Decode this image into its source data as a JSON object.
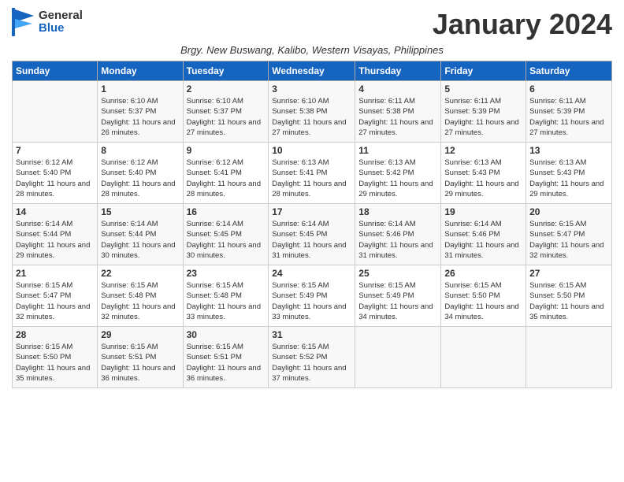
{
  "header": {
    "logo_general": "General",
    "logo_blue": "Blue",
    "month_title": "January 2024",
    "subtitle": "Brgy. New Buswang, Kalibo, Western Visayas, Philippines"
  },
  "days_of_week": [
    "Sunday",
    "Monday",
    "Tuesday",
    "Wednesday",
    "Thursday",
    "Friday",
    "Saturday"
  ],
  "weeks": [
    [
      {
        "day": "",
        "info": ""
      },
      {
        "day": "1",
        "info": "Sunrise: 6:10 AM\nSunset: 5:37 PM\nDaylight: 11 hours and 26 minutes."
      },
      {
        "day": "2",
        "info": "Sunrise: 6:10 AM\nSunset: 5:37 PM\nDaylight: 11 hours and 27 minutes."
      },
      {
        "day": "3",
        "info": "Sunrise: 6:10 AM\nSunset: 5:38 PM\nDaylight: 11 hours and 27 minutes."
      },
      {
        "day": "4",
        "info": "Sunrise: 6:11 AM\nSunset: 5:38 PM\nDaylight: 11 hours and 27 minutes."
      },
      {
        "day": "5",
        "info": "Sunrise: 6:11 AM\nSunset: 5:39 PM\nDaylight: 11 hours and 27 minutes."
      },
      {
        "day": "6",
        "info": "Sunrise: 6:11 AM\nSunset: 5:39 PM\nDaylight: 11 hours and 27 minutes."
      }
    ],
    [
      {
        "day": "7",
        "info": "Sunrise: 6:12 AM\nSunset: 5:40 PM\nDaylight: 11 hours and 28 minutes."
      },
      {
        "day": "8",
        "info": "Sunrise: 6:12 AM\nSunset: 5:40 PM\nDaylight: 11 hours and 28 minutes."
      },
      {
        "day": "9",
        "info": "Sunrise: 6:12 AM\nSunset: 5:41 PM\nDaylight: 11 hours and 28 minutes."
      },
      {
        "day": "10",
        "info": "Sunrise: 6:13 AM\nSunset: 5:41 PM\nDaylight: 11 hours and 28 minutes."
      },
      {
        "day": "11",
        "info": "Sunrise: 6:13 AM\nSunset: 5:42 PM\nDaylight: 11 hours and 29 minutes."
      },
      {
        "day": "12",
        "info": "Sunrise: 6:13 AM\nSunset: 5:43 PM\nDaylight: 11 hours and 29 minutes."
      },
      {
        "day": "13",
        "info": "Sunrise: 6:13 AM\nSunset: 5:43 PM\nDaylight: 11 hours and 29 minutes."
      }
    ],
    [
      {
        "day": "14",
        "info": "Sunrise: 6:14 AM\nSunset: 5:44 PM\nDaylight: 11 hours and 29 minutes."
      },
      {
        "day": "15",
        "info": "Sunrise: 6:14 AM\nSunset: 5:44 PM\nDaylight: 11 hours and 30 minutes."
      },
      {
        "day": "16",
        "info": "Sunrise: 6:14 AM\nSunset: 5:45 PM\nDaylight: 11 hours and 30 minutes."
      },
      {
        "day": "17",
        "info": "Sunrise: 6:14 AM\nSunset: 5:45 PM\nDaylight: 11 hours and 31 minutes."
      },
      {
        "day": "18",
        "info": "Sunrise: 6:14 AM\nSunset: 5:46 PM\nDaylight: 11 hours and 31 minutes."
      },
      {
        "day": "19",
        "info": "Sunrise: 6:14 AM\nSunset: 5:46 PM\nDaylight: 11 hours and 31 minutes."
      },
      {
        "day": "20",
        "info": "Sunrise: 6:15 AM\nSunset: 5:47 PM\nDaylight: 11 hours and 32 minutes."
      }
    ],
    [
      {
        "day": "21",
        "info": "Sunrise: 6:15 AM\nSunset: 5:47 PM\nDaylight: 11 hours and 32 minutes."
      },
      {
        "day": "22",
        "info": "Sunrise: 6:15 AM\nSunset: 5:48 PM\nDaylight: 11 hours and 32 minutes."
      },
      {
        "day": "23",
        "info": "Sunrise: 6:15 AM\nSunset: 5:48 PM\nDaylight: 11 hours and 33 minutes."
      },
      {
        "day": "24",
        "info": "Sunrise: 6:15 AM\nSunset: 5:49 PM\nDaylight: 11 hours and 33 minutes."
      },
      {
        "day": "25",
        "info": "Sunrise: 6:15 AM\nSunset: 5:49 PM\nDaylight: 11 hours and 34 minutes."
      },
      {
        "day": "26",
        "info": "Sunrise: 6:15 AM\nSunset: 5:50 PM\nDaylight: 11 hours and 34 minutes."
      },
      {
        "day": "27",
        "info": "Sunrise: 6:15 AM\nSunset: 5:50 PM\nDaylight: 11 hours and 35 minutes."
      }
    ],
    [
      {
        "day": "28",
        "info": "Sunrise: 6:15 AM\nSunset: 5:50 PM\nDaylight: 11 hours and 35 minutes."
      },
      {
        "day": "29",
        "info": "Sunrise: 6:15 AM\nSunset: 5:51 PM\nDaylight: 11 hours and 36 minutes."
      },
      {
        "day": "30",
        "info": "Sunrise: 6:15 AM\nSunset: 5:51 PM\nDaylight: 11 hours and 36 minutes."
      },
      {
        "day": "31",
        "info": "Sunrise: 6:15 AM\nSunset: 5:52 PM\nDaylight: 11 hours and 37 minutes."
      },
      {
        "day": "",
        "info": ""
      },
      {
        "day": "",
        "info": ""
      },
      {
        "day": "",
        "info": ""
      }
    ]
  ]
}
